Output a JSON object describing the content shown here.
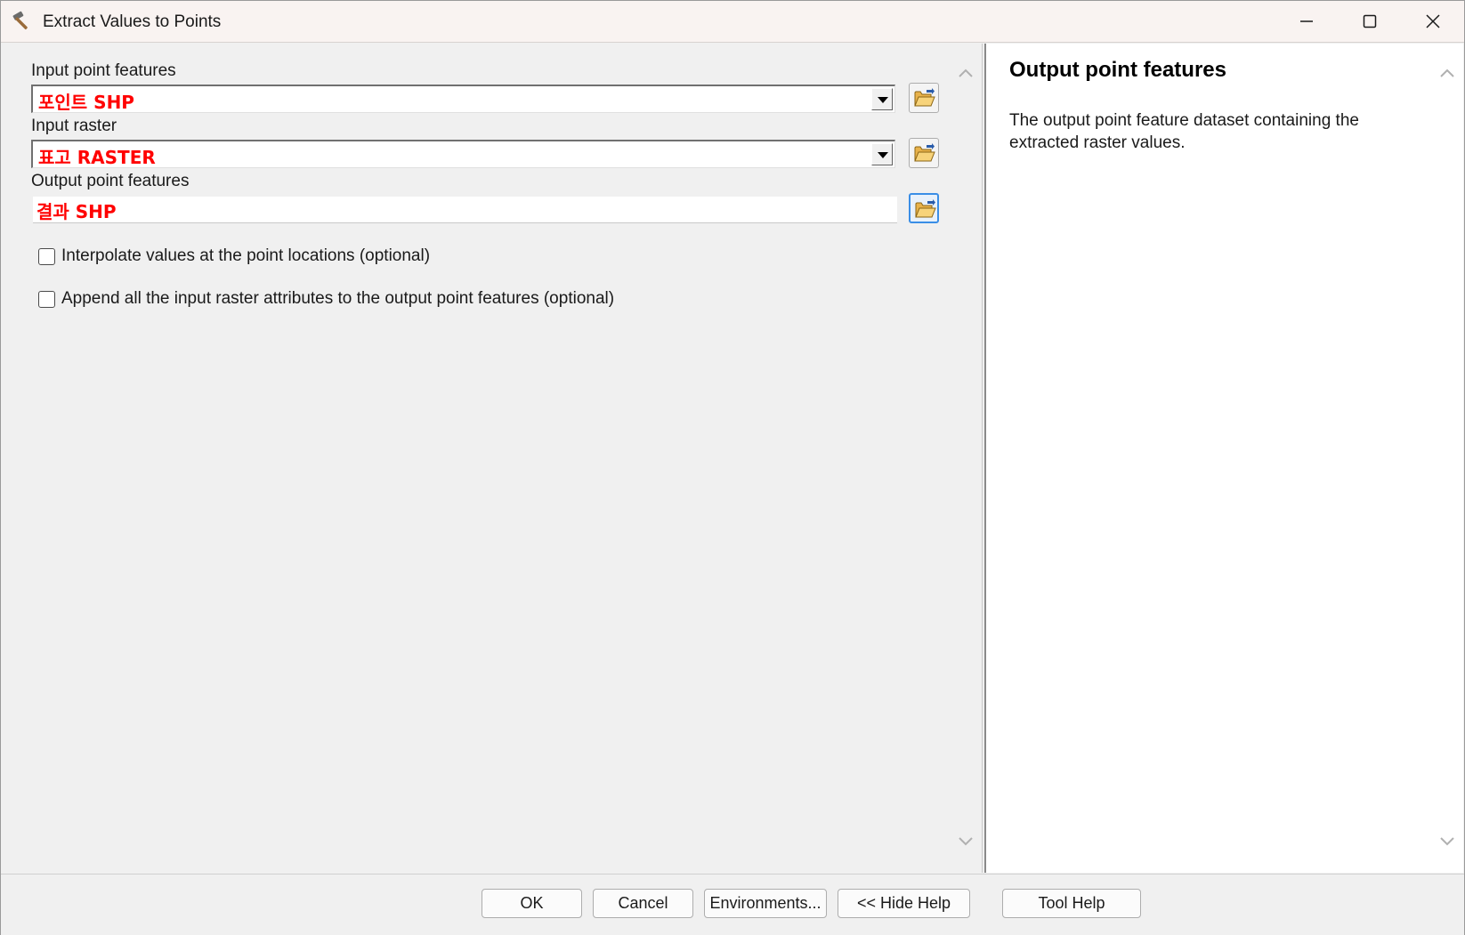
{
  "window": {
    "title": "Extract Values to Points"
  },
  "params": {
    "input_point_label": "Input point features",
    "input_point_value": "포인트 SHP",
    "input_raster_label": "Input raster",
    "input_raster_value": "표고 RASTER",
    "output_point_label": "Output point features",
    "output_point_value": "결과 SHP",
    "interpolate_label": "Interpolate values at the point locations (optional)",
    "append_label": "Append all the input raster attributes to the output point features (optional)"
  },
  "help": {
    "title": "Output point features",
    "body": "The output point feature dataset containing the extracted raster values."
  },
  "buttons": {
    "ok": "OK",
    "cancel": "Cancel",
    "environments": "Environments...",
    "hide_help": "<< Hide Help",
    "tool_help": "Tool Help"
  },
  "colors": {
    "field_value": "#ff0000",
    "accent": "#3a8ee6"
  },
  "icons": {
    "title": "hammer-icon",
    "browse": "open-folder-icon",
    "dropdown": "dropdown-arrow-icon"
  }
}
